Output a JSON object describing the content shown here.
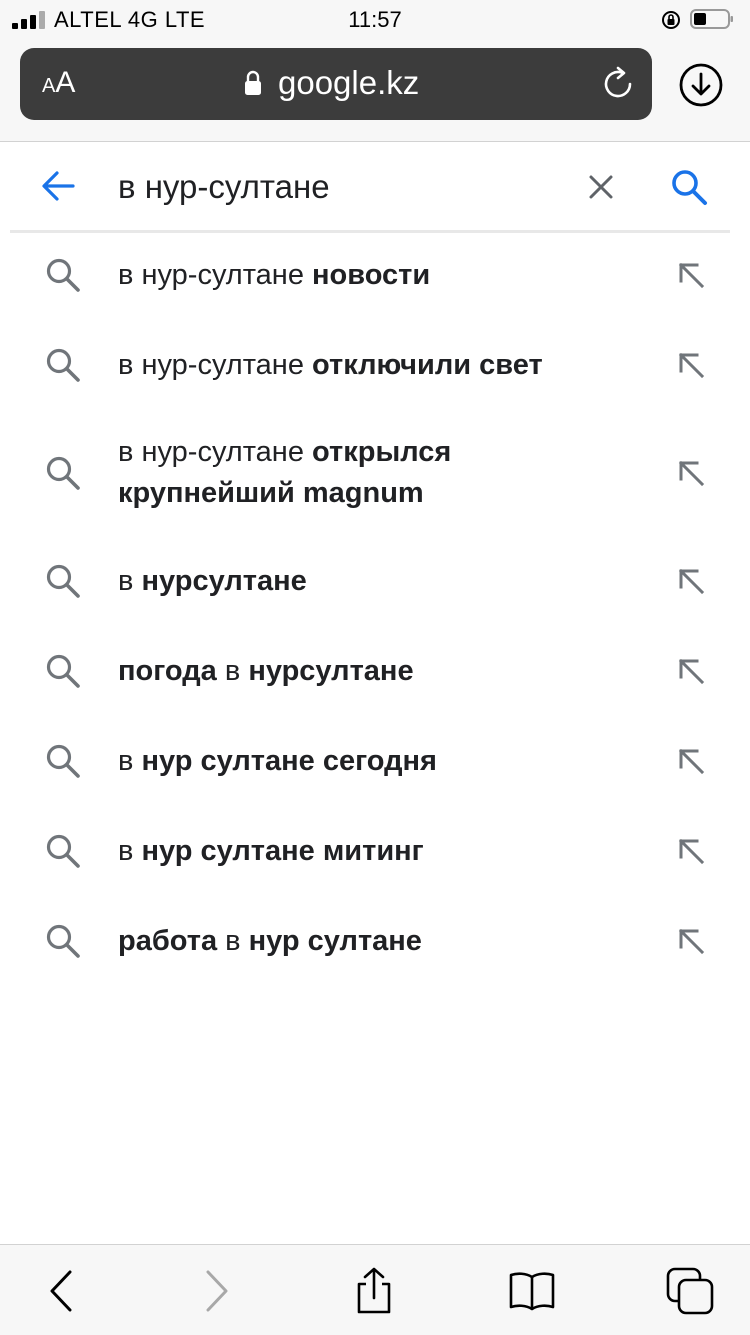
{
  "status_bar": {
    "carrier": "ALTEL 4G LTE",
    "time": "11:57"
  },
  "safari": {
    "text_size_label": "AA",
    "domain": "google.kz",
    "icons": [
      "lock-icon",
      "reload-icon",
      "download-icon"
    ]
  },
  "search": {
    "query": "в нур-султане",
    "icons": [
      "back-arrow-icon",
      "clear-icon",
      "search-icon"
    ],
    "accent_color": "#1a73e8"
  },
  "suggestions": [
    {
      "parts": [
        {
          "text": "в нур-султане ",
          "bold": false
        },
        {
          "text": "новости",
          "bold": true
        }
      ]
    },
    {
      "parts": [
        {
          "text": "в нур-султане ",
          "bold": false
        },
        {
          "text": "отключили свет",
          "bold": true
        }
      ]
    },
    {
      "parts": [
        {
          "text": "в нур-султане ",
          "bold": false
        },
        {
          "text": "открылся крупнейший magnum",
          "bold": true
        }
      ]
    },
    {
      "parts": [
        {
          "text": "в ",
          "bold": false
        },
        {
          "text": "нурсултане",
          "bold": true
        }
      ]
    },
    {
      "parts": [
        {
          "text": "погода",
          "bold": true
        },
        {
          "text": " в ",
          "bold": false
        },
        {
          "text": "нурсултане",
          "bold": true
        }
      ]
    },
    {
      "parts": [
        {
          "text": "в ",
          "bold": false
        },
        {
          "text": "нур султане сегодня",
          "bold": true
        }
      ]
    },
    {
      "parts": [
        {
          "text": "в ",
          "bold": false
        },
        {
          "text": "нур султане митинг",
          "bold": true
        }
      ]
    },
    {
      "parts": [
        {
          "text": "работа",
          "bold": true
        },
        {
          "text": " в ",
          "bold": false
        },
        {
          "text": "нур султане",
          "bold": true
        }
      ]
    }
  ],
  "toolbar": {
    "icons": [
      "back-icon",
      "forward-icon",
      "share-icon",
      "bookmarks-icon",
      "tabs-icon"
    ]
  }
}
